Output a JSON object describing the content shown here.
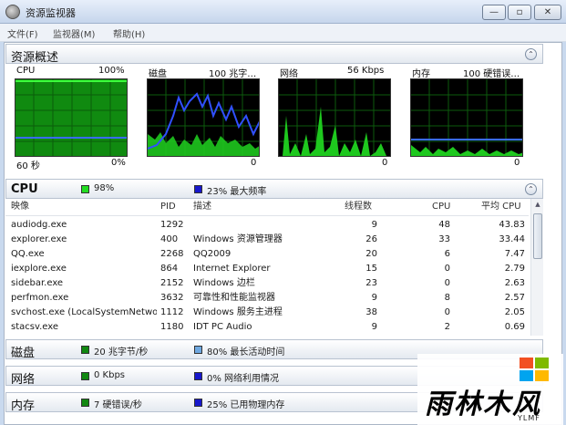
{
  "window": {
    "title": "资源监视器",
    "minimize": "—",
    "maximize": "▫",
    "close": "✕"
  },
  "menu": [
    "文件(F)",
    "监视器(M)",
    "帮助(H)"
  ],
  "overview": {
    "title": "资源概述",
    "collapse": "⌃",
    "graphs": [
      {
        "name": "CPU",
        "max": "100%",
        "foot_left": "60 秒",
        "foot_right": "0%"
      },
      {
        "name": "磁盘",
        "max": "100 兆字…",
        "foot_left": "",
        "foot_right": "0"
      },
      {
        "name": "网络",
        "max": "56 Kbps",
        "foot_left": "",
        "foot_right": "0"
      },
      {
        "name": "内存",
        "max": "100 硬错误…",
        "foot_left": "",
        "foot_right": "0"
      }
    ]
  },
  "cpu": {
    "title": "CPU",
    "usage": "98%",
    "usage_color": "#22dd22",
    "freq": "23% 最大频率",
    "freq_color": "#1818cc",
    "collapse": "⌃",
    "columns": [
      "映像",
      "PID",
      "描述",
      "线程数",
      "CPU",
      "平均 CPU"
    ],
    "rows": [
      [
        "audiodg.exe",
        "1292",
        "",
        "9",
        "48",
        "43.83"
      ],
      [
        "explorer.exe",
        "400",
        "Windows 资源管理器",
        "26",
        "33",
        "33.44"
      ],
      [
        "QQ.exe",
        "2268",
        "QQ2009",
        "20",
        "6",
        "7.47"
      ],
      [
        "iexplore.exe",
        "864",
        "Internet Explorer",
        "15",
        "0",
        "2.79"
      ],
      [
        "sidebar.exe",
        "2152",
        "Windows 边栏",
        "23",
        "0",
        "2.63"
      ],
      [
        "perfmon.exe",
        "3632",
        "可靠性和性能监视器",
        "9",
        "8",
        "2.57"
      ],
      [
        "svchost.exe (LocalSystemNetwor…",
        "1112",
        "Windows 服务主进程",
        "38",
        "0",
        "2.05"
      ],
      [
        "stacsv.exe",
        "1180",
        "IDT PC Audio",
        "9",
        "2",
        "0.69"
      ]
    ]
  },
  "disk": {
    "title": "磁盘",
    "rate": "20 兆字节/秒",
    "rate_color": "#118811",
    "active": "80% 最长活动时间",
    "active_color": "#6fa8e0"
  },
  "network": {
    "title": "网络",
    "rate": "0 Kbps",
    "rate_color": "#118811",
    "usage": "0% 网络利用情况",
    "usage_color": "#1818cc"
  },
  "memory": {
    "title": "内存",
    "faults": "7 硬错误/秒",
    "faults_color": "#118811",
    "used": "25% 已用物理内存",
    "used_color": "#1818cc"
  },
  "watermark": {
    "text": "雨林木风",
    "sub": "YLMF",
    "flag_colors": [
      "#f25022",
      "#7fba00",
      "#00a4ef",
      "#ffb900"
    ]
  }
}
